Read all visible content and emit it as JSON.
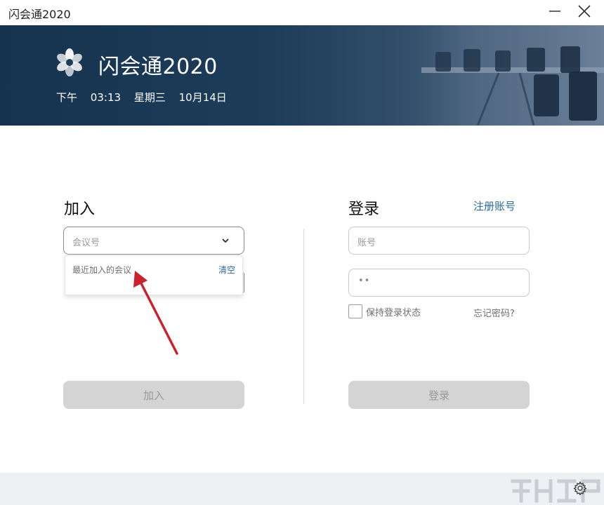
{
  "window": {
    "title": "闪会通2020",
    "minimize_icon": "minimize-icon",
    "close_icon": "close-icon"
  },
  "banner": {
    "brand": "闪会通2020",
    "logo_icon": "app-logo-icon",
    "clock": {
      "period": "下午",
      "time": "03:13",
      "weekday": "星期三",
      "date": "10月14日"
    }
  },
  "join": {
    "title": "加入",
    "meeting_id_placeholder": "会议号",
    "dropdown": {
      "recent_label": "最近加入的会议",
      "clear_label": "清空"
    },
    "button_label": "加入"
  },
  "login": {
    "title": "登录",
    "register_label": "注册账号",
    "account_placeholder": "账号",
    "password_mask": "••",
    "remember_label": "保持登录状态",
    "forgot_label": "忘记密码?",
    "button_label": "登录"
  },
  "footer": {
    "settings_icon": "gear-icon"
  },
  "colors": {
    "banner_dark": "#15334e",
    "link": "#2b6a9e",
    "disabled_button": "#d4d4d4",
    "annotation_arrow": "#c8232b"
  }
}
